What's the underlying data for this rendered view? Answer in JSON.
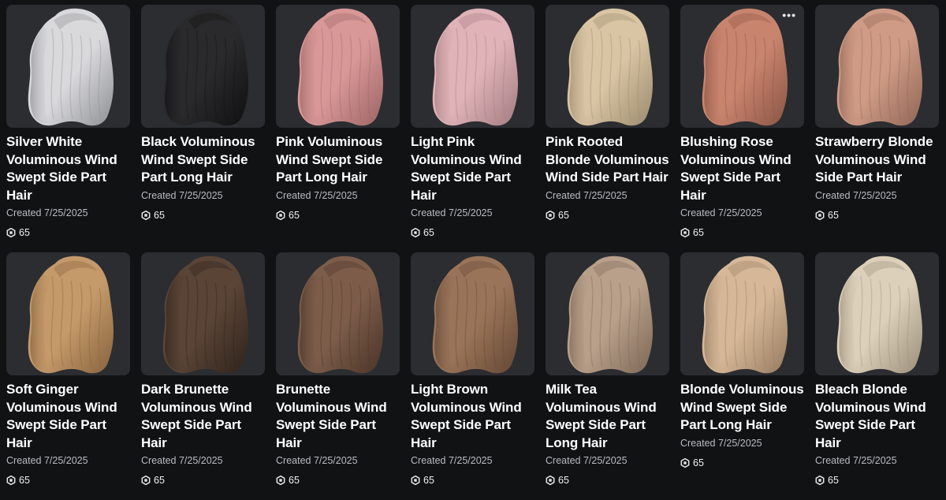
{
  "items": [
    {
      "name": "Silver White Voluminous Wind Swept Side Part Hair",
      "created": "Created 7/25/2025",
      "price": "65",
      "hair_color": "#d9d9dc",
      "shadow_color": "#8e8f93",
      "show_more": false
    },
    {
      "name": "Black Voluminous Wind Swept Side Part Long Hair",
      "created": "Created 7/25/2025",
      "price": "65",
      "hair_color": "#2a2a2c",
      "shadow_color": "#101012",
      "show_more": false
    },
    {
      "name": "Pink Voluminous Wind Swept Side Part Long Hair",
      "created": "Created 7/25/2025",
      "price": "65",
      "hair_color": "#d99898",
      "shadow_color": "#9c6463",
      "show_more": false
    },
    {
      "name": "Light Pink Voluminous Wind Swept Side Part Hair",
      "created": "Created 7/25/2025",
      "price": "65",
      "hair_color": "#e0b3b8",
      "shadow_color": "#a27c80",
      "show_more": false
    },
    {
      "name": "Pink Rooted Blonde Voluminous Wind Side Part Hair",
      "created": "Created 7/25/2025",
      "price": "65",
      "hair_color": "#d9c5a3",
      "shadow_color": "#9b8a6e",
      "show_more": false
    },
    {
      "name": "Blushing Rose Voluminous Wind Swept Side Part Hair",
      "created": "Created 7/25/2025",
      "price": "65",
      "hair_color": "#c9846e",
      "shadow_color": "#8a5444",
      "show_more": true
    },
    {
      "name": "Strawberry Blonde Voluminous Wind Side Part Hair",
      "created": "Created 7/25/2025",
      "price": "65",
      "hair_color": "#cf9b86",
      "shadow_color": "#8f6555",
      "show_more": false
    },
    {
      "name": "Soft Ginger Voluminous Wind Swept Side Part Hair",
      "created": "Created 7/25/2025",
      "price": "65",
      "hair_color": "#c59a6a",
      "shadow_color": "#86623d",
      "show_more": false
    },
    {
      "name": "Dark Brunette Voluminous Wind Swept Side Part Hair",
      "created": "Created 7/25/2025",
      "price": "65",
      "hair_color": "#5a4436",
      "shadow_color": "#2f231b",
      "show_more": false
    },
    {
      "name": "Brunette Voluminous Wind Swept Side Part Hair",
      "created": "Created 7/25/2025",
      "price": "65",
      "hair_color": "#7d5d4a",
      "shadow_color": "#4a3428",
      "show_more": false
    },
    {
      "name": "Light Brown Voluminous Wind Swept Side Part Hair",
      "created": "Created 7/25/2025",
      "price": "65",
      "hair_color": "#9a7459",
      "shadow_color": "#624633",
      "show_more": false
    },
    {
      "name": "Milk Tea Voluminous Wind Swept Side Part Long Hair",
      "created": "Created 7/25/2025",
      "price": "65",
      "hair_color": "#b8a08a",
      "shadow_color": "#7c6755",
      "show_more": false
    },
    {
      "name": "Blonde Voluminous Wind Swept Side Part Long Hair",
      "created": "Created 7/25/2025",
      "price": "65",
      "hair_color": "#d6b898",
      "shadow_color": "#967a5e",
      "show_more": false
    },
    {
      "name": "Bleach Blonde Voluminous Wind Swept Side Part Hair",
      "created": "Created 7/25/2025",
      "price": "65",
      "hair_color": "#dcd0bb",
      "shadow_color": "#9a8e7a",
      "show_more": false
    }
  ],
  "more_label": "•••",
  "currency_icon": "robux-icon"
}
